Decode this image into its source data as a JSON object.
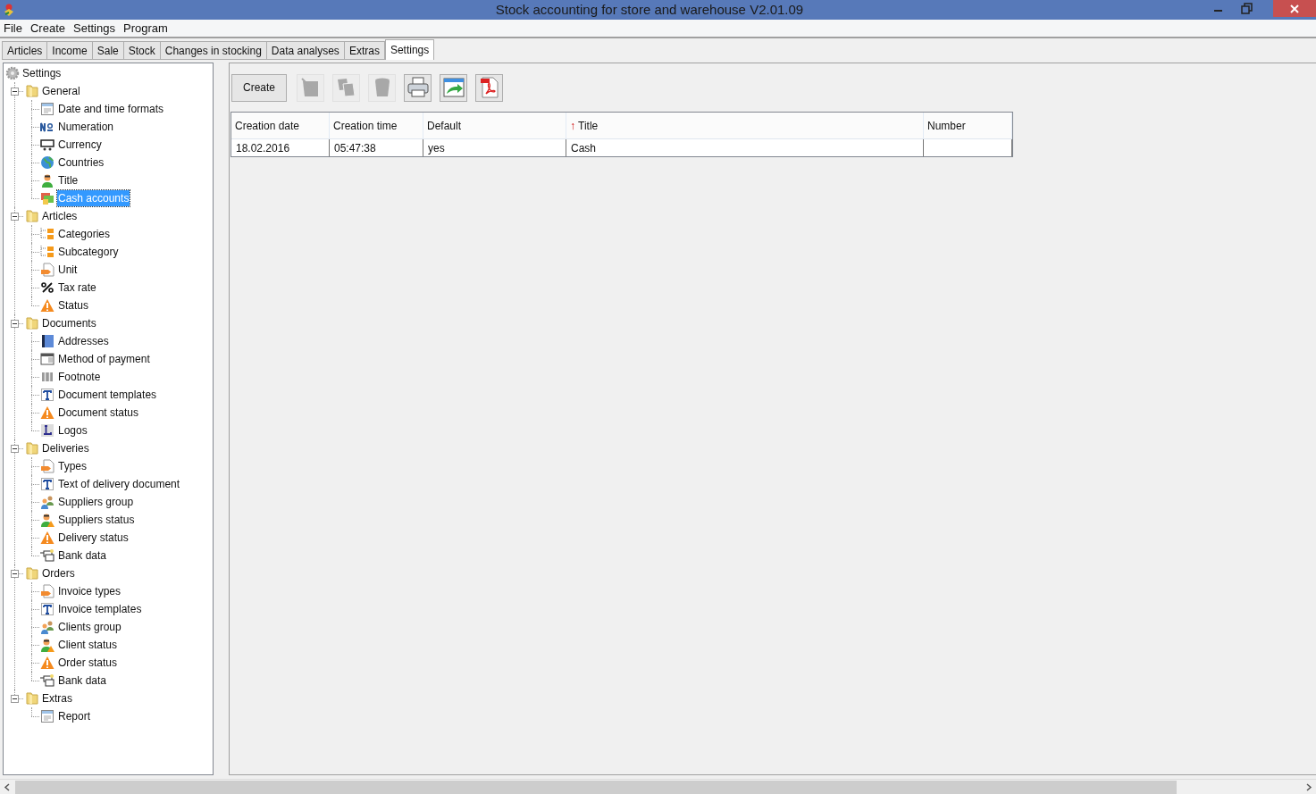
{
  "window": {
    "title": "Stock accounting for store and warehouse V2.01.09"
  },
  "menu": [
    "File",
    "Create",
    "Settings",
    "Program"
  ],
  "tabs": [
    {
      "label": "Articles",
      "selected": false
    },
    {
      "label": "Income",
      "selected": false
    },
    {
      "label": "Sale",
      "selected": false
    },
    {
      "label": "Stock",
      "selected": false
    },
    {
      "label": "Changes in stocking",
      "selected": false
    },
    {
      "label": "Data analyses",
      "selected": false
    },
    {
      "label": "Extras",
      "selected": false
    },
    {
      "label": "Settings",
      "selected": true
    }
  ],
  "tree": {
    "label": "Settings",
    "kind": "gear",
    "children": [
      {
        "label": "General",
        "kind": "folder",
        "expanded": true,
        "children": [
          {
            "label": "Date and time formats",
            "kind": "form",
            "selected": false
          },
          {
            "label": "Numeration",
            "kind": "numero",
            "selected": false
          },
          {
            "label": "Currency",
            "kind": "money",
            "selected": false
          },
          {
            "label": "Countries",
            "kind": "globe",
            "selected": false
          },
          {
            "label": "Title",
            "kind": "person",
            "selected": false
          },
          {
            "label": "Cash accounts",
            "kind": "cash",
            "selected": true
          }
        ]
      },
      {
        "label": "Articles",
        "kind": "folder",
        "expanded": true,
        "children": [
          {
            "label": "Categories",
            "kind": "subfolders",
            "selected": false
          },
          {
            "label": "Subcategory",
            "kind": "subfolders",
            "selected": false
          },
          {
            "label": "Unit",
            "kind": "tagdoc",
            "selected": false
          },
          {
            "label": "Tax rate",
            "kind": "percent",
            "selected": false
          },
          {
            "label": "Status",
            "kind": "warning",
            "selected": false
          }
        ]
      },
      {
        "label": "Documents",
        "kind": "folder",
        "expanded": true,
        "children": [
          {
            "label": "Addresses",
            "kind": "book",
            "selected": false
          },
          {
            "label": "Method of payment",
            "kind": "payment",
            "selected": false
          },
          {
            "label": "Footnote",
            "kind": "columns",
            "selected": false
          },
          {
            "label": "Document templates",
            "kind": "textT",
            "selected": false
          },
          {
            "label": "Document status",
            "kind": "warning",
            "selected": false
          },
          {
            "label": "Logos",
            "kind": "letterL",
            "selected": false
          }
        ]
      },
      {
        "label": "Deliveries",
        "kind": "folder",
        "expanded": true,
        "children": [
          {
            "label": "Types",
            "kind": "tagdoc",
            "selected": false
          },
          {
            "label": "Text of delivery document",
            "kind": "textT",
            "selected": false
          },
          {
            "label": "Suppliers group",
            "kind": "people",
            "selected": false
          },
          {
            "label": "Suppliers status",
            "kind": "personwarn",
            "selected": false
          },
          {
            "label": "Delivery status",
            "kind": "warning",
            "selected": false
          },
          {
            "label": "Bank data",
            "kind": "bank",
            "selected": false
          }
        ]
      },
      {
        "label": "Orders",
        "kind": "folder",
        "expanded": true,
        "children": [
          {
            "label": "Invoice types",
            "kind": "tagdoc",
            "selected": false
          },
          {
            "label": "Invoice templates",
            "kind": "textT",
            "selected": false
          },
          {
            "label": "Clients group",
            "kind": "people",
            "selected": false
          },
          {
            "label": "Client status",
            "kind": "personwarn",
            "selected": false
          },
          {
            "label": "Order status",
            "kind": "warning",
            "selected": false
          },
          {
            "label": "Bank data",
            "kind": "bank",
            "selected": false
          }
        ]
      },
      {
        "label": "Extras",
        "kind": "folder",
        "expanded": true,
        "children": [
          {
            "label": "Report",
            "kind": "form",
            "selected": false
          }
        ]
      }
    ]
  },
  "toolbar": [
    {
      "kind": "text",
      "label": "Create",
      "disabled": false
    },
    {
      "kind": "edit",
      "disabled": true
    },
    {
      "kind": "copy",
      "disabled": true
    },
    {
      "kind": "trash",
      "disabled": true
    },
    {
      "kind": "print",
      "disabled": false
    },
    {
      "kind": "export",
      "disabled": false
    },
    {
      "kind": "pdf",
      "disabled": false
    }
  ],
  "table": {
    "columns": [
      {
        "label": "Creation date"
      },
      {
        "label": "Creation time"
      },
      {
        "label": "Default"
      },
      {
        "label": "Title",
        "sort_arrow": "↑"
      },
      {
        "label": "Number"
      }
    ],
    "rows": [
      [
        "18.02.2016",
        "05:47:38",
        "yes",
        "Cash",
        ""
      ]
    ]
  }
}
